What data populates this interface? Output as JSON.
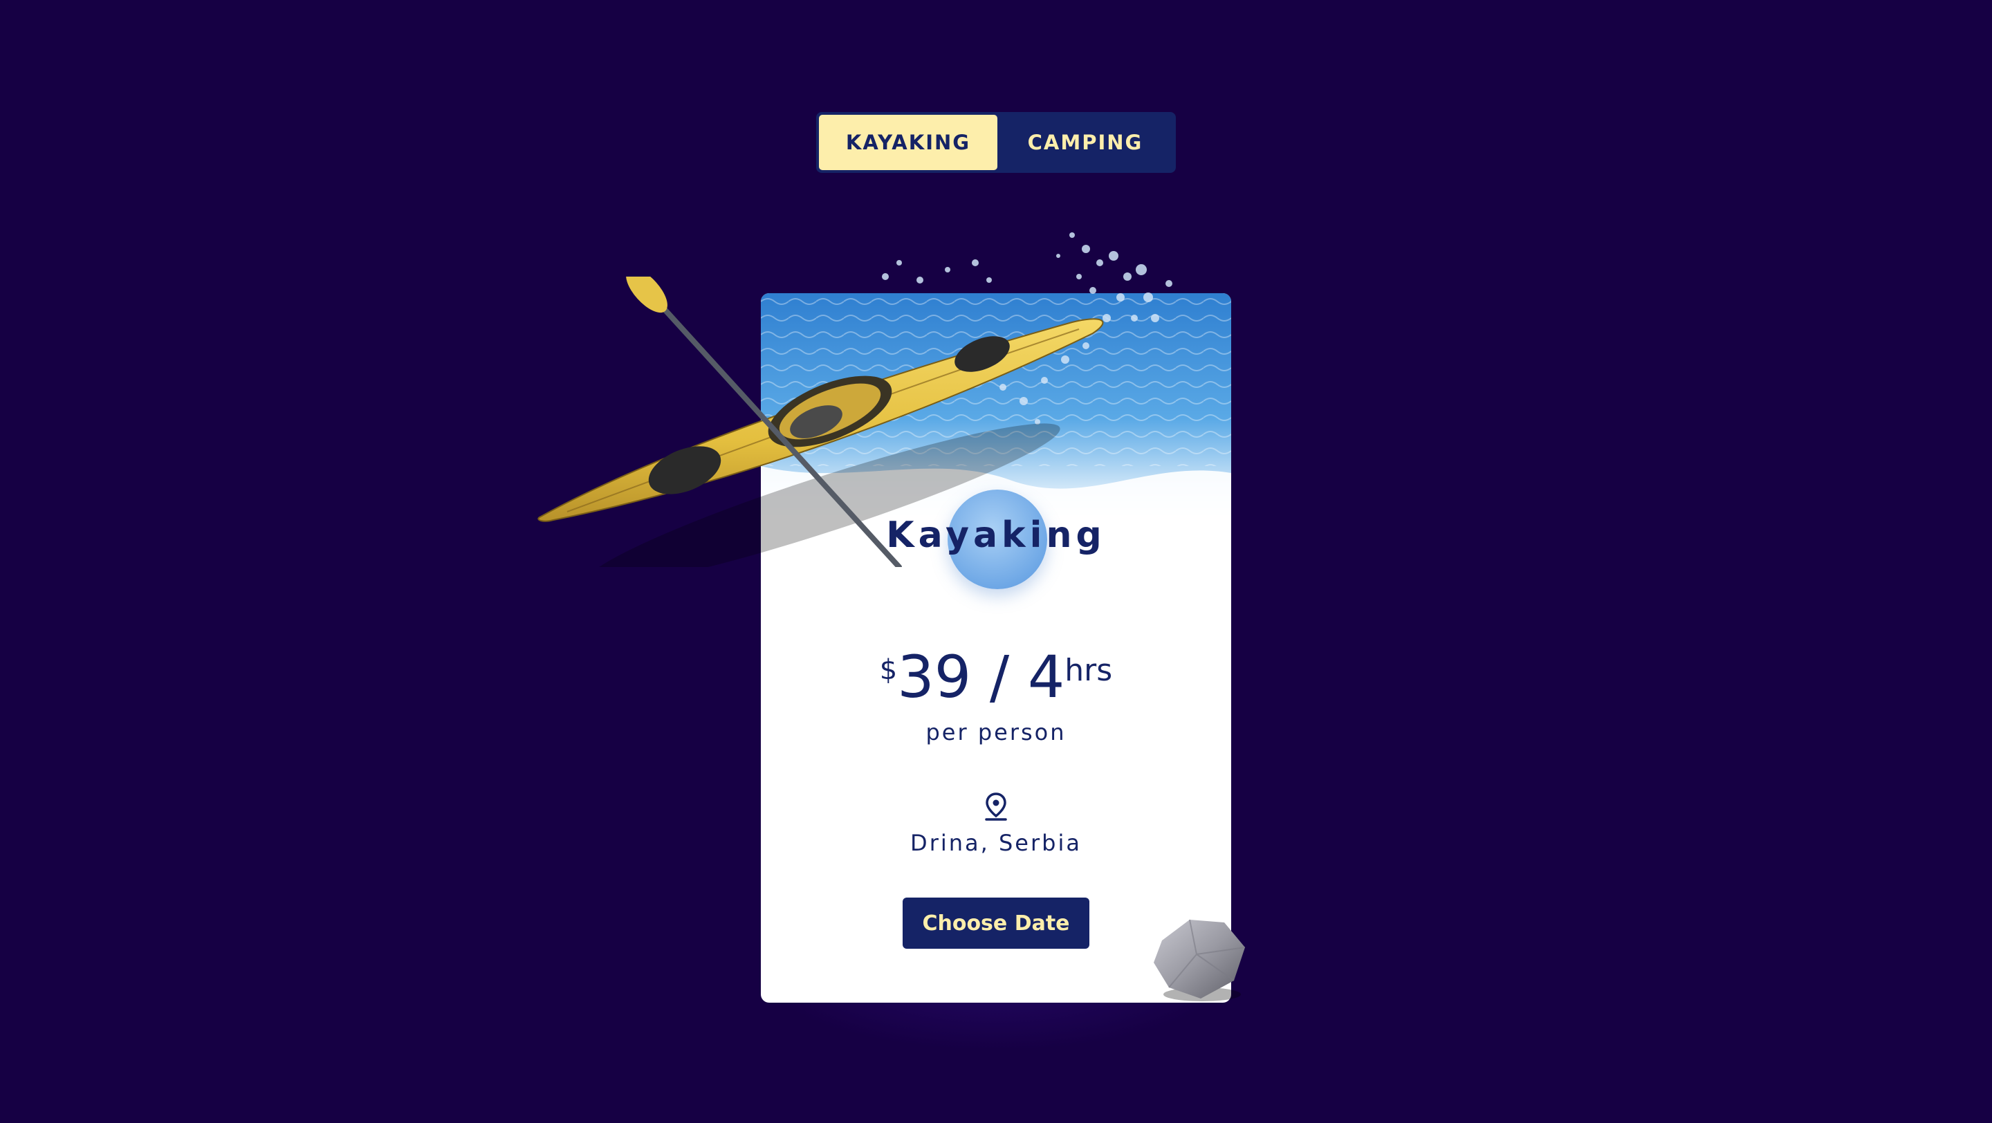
{
  "tabs": [
    {
      "label": "KAYAKING",
      "active": true
    },
    {
      "label": "CAMPING",
      "active": false
    }
  ],
  "card": {
    "title": "Kayaking",
    "price": {
      "currency": "$",
      "main": "39 / 4",
      "unit": "hrs"
    },
    "per_person": "per person",
    "location": "Drina, Serbia",
    "button_label": "Choose Date"
  },
  "icons": {
    "location": "location-pin-icon"
  },
  "colors": {
    "background": "#160044",
    "navy": "#152366",
    "cream": "#fdeeab",
    "kayak_yellow": "#e9c64a",
    "water_blue": "#3c8fd6"
  }
}
